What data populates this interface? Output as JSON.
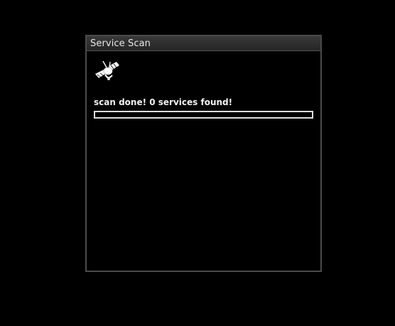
{
  "dialog": {
    "title": "Service Scan",
    "icon": "satellite-icon",
    "status_text": "scan done! 0 services found!",
    "progress": 0
  }
}
